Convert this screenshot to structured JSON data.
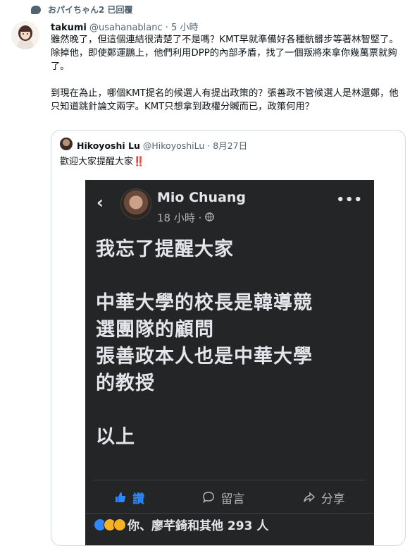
{
  "reply_context": {
    "text": "おパイちゃん2 已回覆"
  },
  "tweet": {
    "display_name": "takumi",
    "handle": "@usahanablanc",
    "time": " · 5 小時",
    "paragraph1": "雖然晚了，但這個連結很清楚了不是嗎？KMT早就準備好各種骯髒步等著林智堅了。除掉他，即使鄭運鵬上，他們利用DPP的內部矛盾，找了一個叛將來拿你幾萬票就夠了。",
    "paragraph2": "到現在為止，哪個KMT提名的候選人有提出政策的？張善政不管候選人是林還鄭，他只知道跳針論文兩字。KMT只想拿到政權分贓而已，政策何用？"
  },
  "quote": {
    "display_name": "Hikoyoshi Lu",
    "handle": "@HikoyoshiLu",
    "date": " · 8月27日",
    "text": "歡迎大家提醒大家",
    "emoji": "‼️"
  },
  "fb_post": {
    "name": "Mio Chuang",
    "time": "18 小時 · ",
    "lines": [
      "我忘了提醒大家",
      "",
      "中華大學的校長是韓導競",
      "選團隊的顧問",
      "張善政本人也是中華大學",
      "的教授",
      "",
      "以上"
    ],
    "like_label": "讚",
    "comment_label": "留言",
    "share_label": "分享",
    "reactions_text": "你、廖芊錡和其他 293 人"
  }
}
